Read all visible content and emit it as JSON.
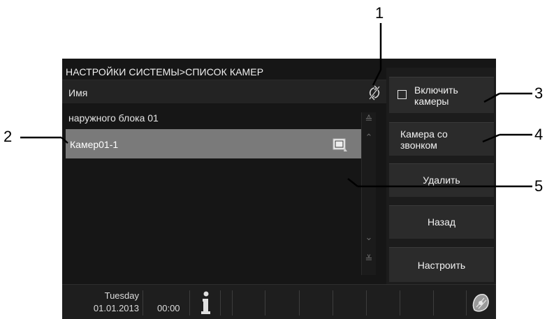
{
  "callouts": [
    "1",
    "2",
    "3",
    "4",
    "5"
  ],
  "screen": {
    "title": "НАСТРОЙКИ СИСТЕМЫ>СПИСОК КАМЕР",
    "list_header": "Имя",
    "list_group": "наружного блока 01",
    "selected_row": "Камер01-1",
    "side_buttons": {
      "enable_cameras": "Включить камеры",
      "doorbell_camera": "Камера со звонком",
      "delete": "Удалить",
      "back": "Назад",
      "configure": "Настроить"
    },
    "status_bar": {
      "day": "Tuesday",
      "date": "01.01.2013",
      "time": "00:00"
    },
    "icons": {
      "refresh": "refresh-icon",
      "row": "camera-select-icon",
      "scroll_up_double": "double-chevron-up-icon",
      "scroll_up": "chevron-up-icon",
      "scroll_down": "chevron-down-icon",
      "scroll_down_double": "double-chevron-down-icon",
      "info": "info-icon",
      "settings": "settings-icon"
    }
  }
}
